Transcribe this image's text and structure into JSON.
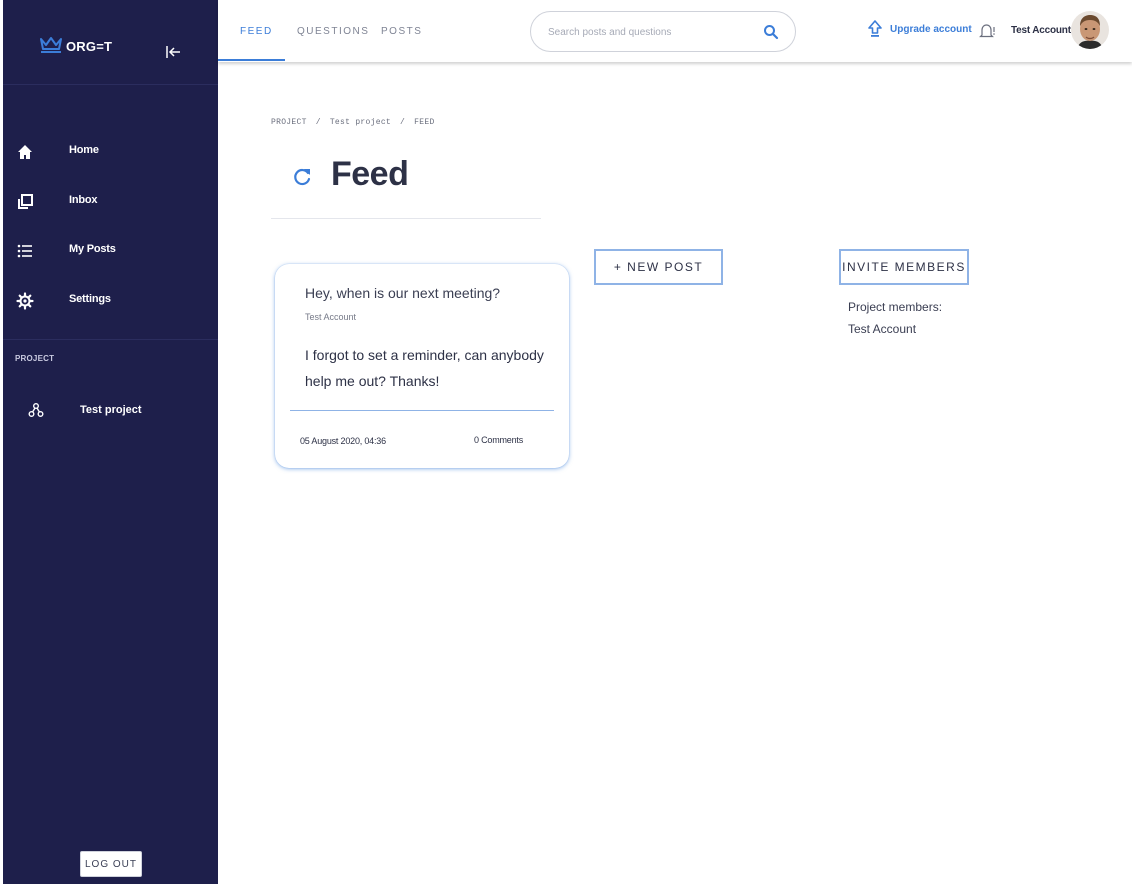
{
  "brand": {
    "name": "ORG=T"
  },
  "sidebar": {
    "items": [
      {
        "label": "Home",
        "icon": "home-icon"
      },
      {
        "label": "Inbox",
        "icon": "inbox-icon"
      },
      {
        "label": "My Posts",
        "icon": "list-icon"
      },
      {
        "label": "Settings",
        "icon": "gear-icon"
      }
    ],
    "section_label": "PROJECT",
    "project": {
      "label": "Test project",
      "icon": "project-nodes-icon"
    },
    "logout_label": "LOG OUT"
  },
  "topbar": {
    "tabs": [
      {
        "label": "FEED",
        "active": true
      },
      {
        "label": "QUESTIONS",
        "active": false
      },
      {
        "label": "POSTS",
        "active": false
      }
    ],
    "search": {
      "placeholder": "Search posts and questions",
      "value": ""
    },
    "upgrade_label": "Upgrade account",
    "account_name": "Test Account"
  },
  "breadcrumb": [
    "PROJECT",
    "Test project",
    "FEED"
  ],
  "breadcrumb_separator": "/",
  "page": {
    "title": "Feed"
  },
  "post": {
    "title": "Hey, when is our next meeting?",
    "author": "Test Account",
    "body": "I forgot to set a reminder, can anybody help me out? Thanks!",
    "date": "05 August 2020, 04:36",
    "comments": "0 Comments"
  },
  "actions": {
    "new_post_label": "+ NEW POST",
    "invite_label": "INVITE MEMBERS"
  },
  "members": {
    "label": "Project members:",
    "list": [
      "Test Account"
    ]
  },
  "colors": {
    "sidebar": "#1e1f4b",
    "accent": "#3b7dd8",
    "text": "#2d3146"
  }
}
